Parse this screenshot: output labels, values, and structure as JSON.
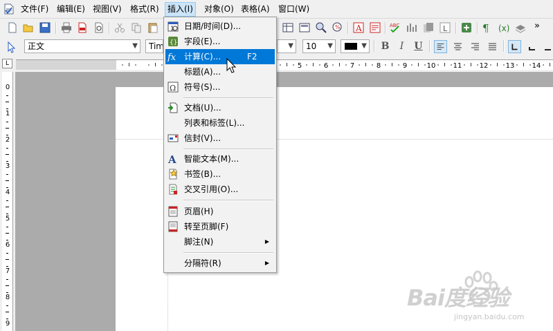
{
  "menubar": {
    "items": [
      "文件(F)",
      "编辑(E)",
      "视图(V)",
      "格式(R)",
      "插入(I)",
      "对象(O)",
      "表格(A)",
      "窗口(W)"
    ],
    "active_index": 4
  },
  "toolbar1": {
    "overflow_label": "»"
  },
  "toolbar2": {
    "style_value": "正文",
    "font_value": "Time",
    "size_value": "10",
    "bold_label": "B",
    "italic_label": "I",
    "underline_label": "U",
    "font_color": "#000000"
  },
  "h_ruler": {
    "numbers": [
      "5",
      "6",
      "7",
      "8",
      "9",
      "10",
      "11",
      "12",
      "13",
      "14"
    ]
  },
  "v_ruler": {
    "numbers": [
      "0",
      "1",
      "2",
      "3",
      "4",
      "5",
      "6",
      "7",
      "8",
      "9"
    ]
  },
  "tab_selector": "L",
  "insert_menu": {
    "items": [
      {
        "label": "日期/时间(D)...",
        "icon": "calendar-icon"
      },
      {
        "label": "字段(E)...",
        "icon": "field-icon"
      },
      {
        "label": "计算(C)...",
        "icon": "formula-icon",
        "shortcut": "F2",
        "highlighted": true
      },
      {
        "label": "标题(A)...",
        "icon": ""
      },
      {
        "label": "符号(S)...",
        "icon": "symbol-icon"
      },
      {
        "label": "文档(U)...",
        "icon": "document-icon"
      },
      {
        "label": "列表和标签(L)...",
        "icon": ""
      },
      {
        "label": "信封(V)...",
        "icon": "envelope-icon"
      },
      {
        "label": "智能文本(M)...",
        "icon": "smart-text-icon"
      },
      {
        "label": "书签(B)...",
        "icon": "bookmark-icon"
      },
      {
        "label": "交叉引用(O)...",
        "icon": "cross-reference-icon"
      },
      {
        "label": "页眉(H)",
        "icon": "header-icon"
      },
      {
        "label": "转至页脚(F)",
        "icon": "footer-icon"
      },
      {
        "label": "脚注(N)",
        "icon": "",
        "submenu": true
      },
      {
        "label": "分隔符(R)",
        "icon": "",
        "submenu": true
      }
    ],
    "submenu_arrow": "▶"
  },
  "watermark": {
    "logo": "Bai度经验",
    "url": "jingyan.baidu.com"
  },
  "colors": {
    "highlight": "#0078d7",
    "menu_active_bg": "#cce4f7",
    "doc_bg": "#ababab"
  }
}
